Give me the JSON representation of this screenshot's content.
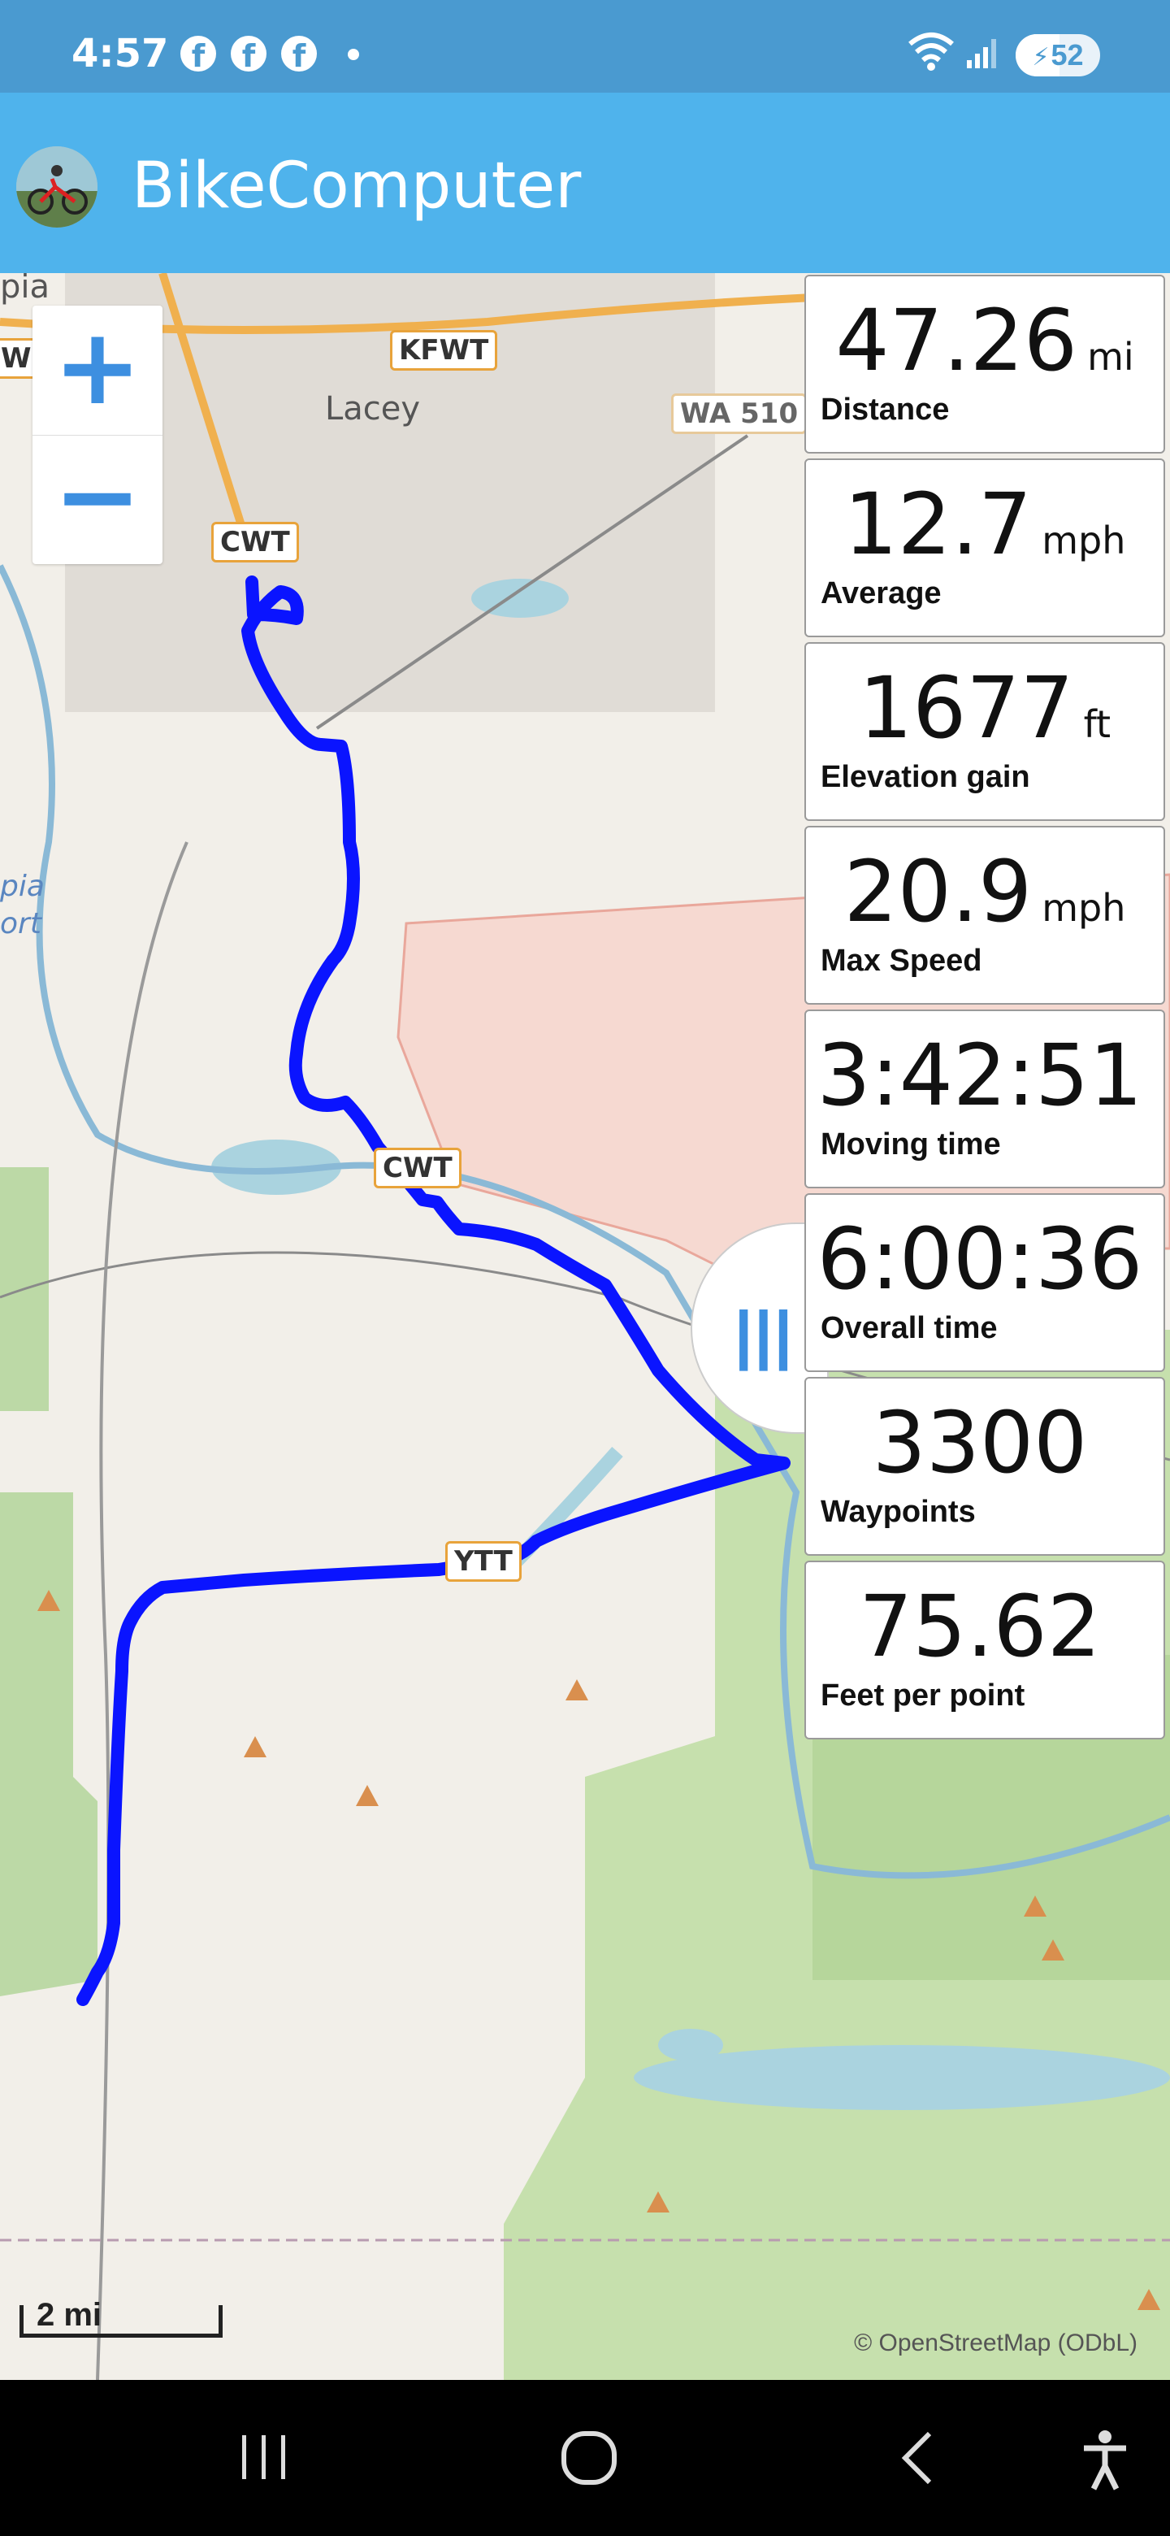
{
  "status_bar": {
    "time": "4:57",
    "notification_icons": [
      "facebook-icon",
      "facebook-icon",
      "facebook-icon"
    ],
    "battery_level": "52",
    "battery_fraction": 0.52
  },
  "app": {
    "title": "BikeComputer",
    "accent_color": "#4fb3ec"
  },
  "map": {
    "zoom_in_label": "+",
    "zoom_out_label": "−",
    "labels": {
      "cwt_north": "CWT",
      "cwt_mid": "CWT",
      "kfwt": "KFWT",
      "wa510": "WA 510",
      "ytt": "YTT",
      "city_lacey": "Lacey",
      "city_olympia": "pia",
      "water_olympia": "pia",
      "water_port": "ort",
      "left_edge": "W"
    },
    "scale_label": "2 mi",
    "attribution": "© OpenStreetMap (ODbL)",
    "route_color": "#0a14ff"
  },
  "stats": [
    {
      "value": "47.26",
      "unit": "mi",
      "label": "Distance"
    },
    {
      "value": "12.7",
      "unit": "mph",
      "label": "Average"
    },
    {
      "value": "1677",
      "unit": "ft",
      "label": "Elevation gain"
    },
    {
      "value": "20.9",
      "unit": "mph",
      "label": "Max Speed"
    },
    {
      "value": "3:42:51",
      "unit": "",
      "label": "Moving time"
    },
    {
      "value": "6:00:36",
      "unit": "",
      "label": "Overall time"
    },
    {
      "value": "3300",
      "unit": "",
      "label": "Waypoints"
    },
    {
      "value": "75.62",
      "unit": "",
      "label": "Feet per point"
    }
  ],
  "panel_handle_label": "|||",
  "nav_bar": {
    "recents": "recents-icon",
    "home": "home-icon",
    "back": "back-icon",
    "accessibility": "accessibility-icon"
  }
}
